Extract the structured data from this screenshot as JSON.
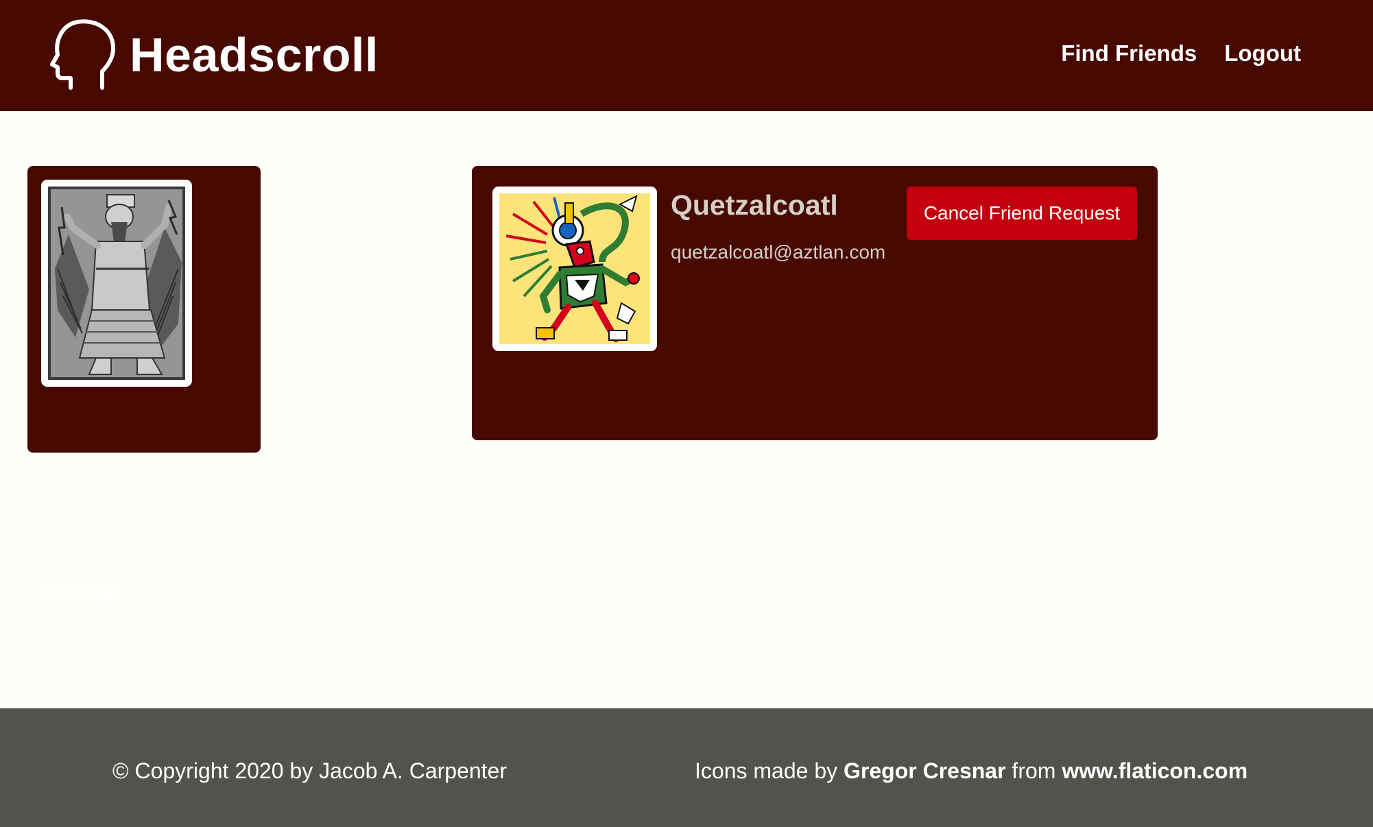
{
  "header": {
    "brand": "Headscroll",
    "nav": {
      "find_friends": "Find Friends",
      "logout": "Logout"
    }
  },
  "me": {
    "name": "Marduk",
    "photo_icon": "marduk-portrait"
  },
  "friend_request": {
    "name": "Quetzalcoatl",
    "email": "quetzalcoatl@aztlan.com",
    "cancel_label": "Cancel Friend Request",
    "photo_icon": "quetzalcoatl-portrait"
  },
  "footer": {
    "copyright": "© Copyright 2020 by Jacob A. Carpenter",
    "credits_prefix": "Icons made by",
    "credits_author": "Gregor Cresnar",
    "credits_middle": "from",
    "credits_site": "www.flaticon.com"
  },
  "colors": {
    "header_bg": "#470800",
    "page_bg": "#fffff9",
    "card_bg": "#470800",
    "button_bg": "#c5000e",
    "footer_bg": "#52534d",
    "muted_text": "#d5cfc6"
  }
}
